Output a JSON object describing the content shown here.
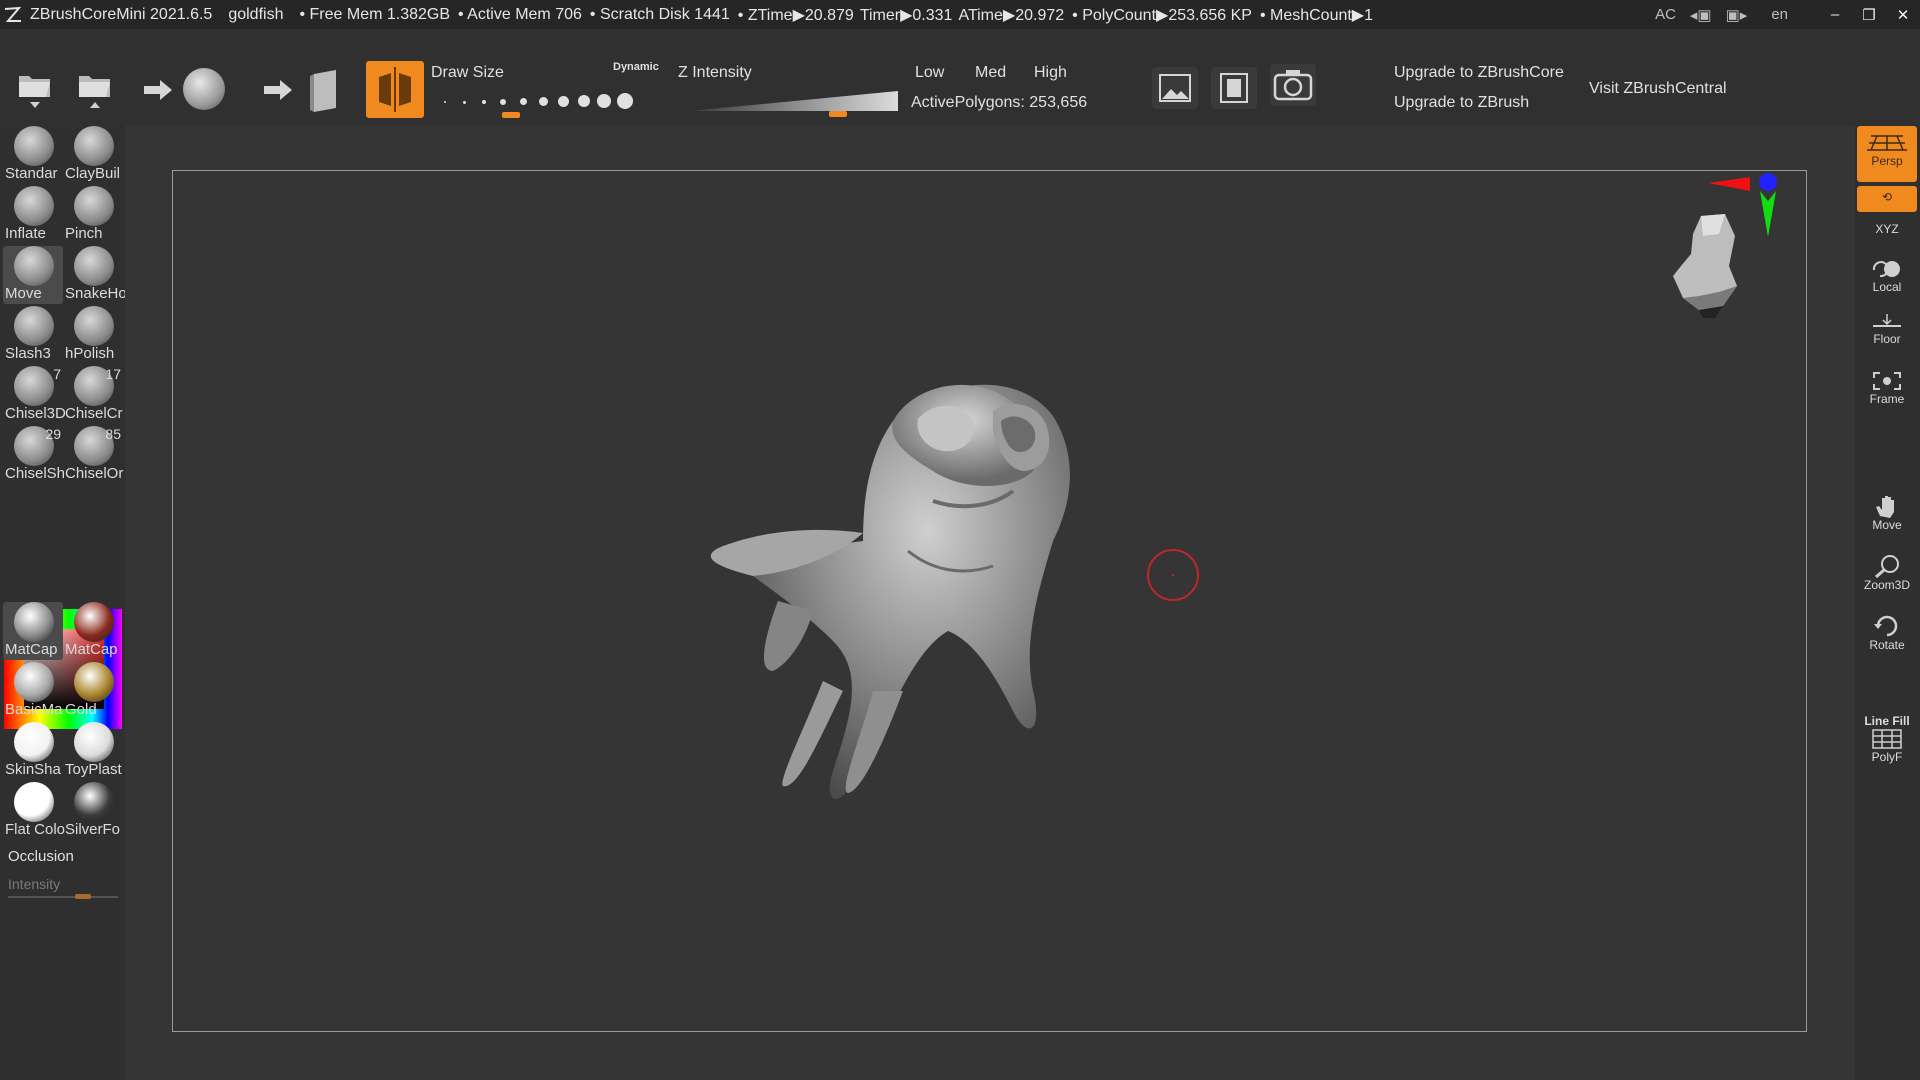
{
  "titlebar": {
    "app": "ZBrushCoreMini 2021.6.5",
    "document": "goldfish",
    "free_mem": "• Free Mem 1.382GB",
    "active_mem": "• Active Mem 706",
    "scratch": "• Scratch Disk 1441",
    "ztime": "• ZTime▶20.879",
    "timer": "Timer▶0.331",
    "atime": "ATime▶20.972",
    "polycount": "• PolyCount▶253.656 KP",
    "meshcount": "• MeshCount▶1",
    "ac": "AC",
    "lang": "en",
    "minimize": "–",
    "restore": "❐",
    "close": "✕"
  },
  "toolbar": {
    "draw_size_label": "Draw Size",
    "dynamic_label": "Dynamic",
    "z_intensity_label": "Z Intensity",
    "low": "Low",
    "med": "Med",
    "high": "High",
    "active_polygons": "ActivePolygons: 253,656",
    "upgrade_core": "Upgrade to ZBrushCore",
    "upgrade_zbrush": "Upgrade to ZBrush",
    "visit_central": "Visit ZBrushCentral"
  },
  "brushes": [
    {
      "name": "Standar",
      "badge": ""
    },
    {
      "name": "ClayBuil",
      "badge": ""
    },
    {
      "name": "Inflate",
      "badge": ""
    },
    {
      "name": "Pinch",
      "badge": ""
    },
    {
      "name": "Move",
      "badge": ""
    },
    {
      "name": "SnakeHo",
      "badge": ""
    },
    {
      "name": "Slash3",
      "badge": ""
    },
    {
      "name": "hPolish",
      "badge": ""
    },
    {
      "name": "Chisel3D",
      "badge": "7"
    },
    {
      "name": "ChiselCr",
      "badge": "17"
    },
    {
      "name": "ChiselSh",
      "badge": "29"
    },
    {
      "name": "ChiselOr",
      "badge": "85"
    }
  ],
  "materials": [
    {
      "name": "MatCap",
      "color": "#8d8d8d"
    },
    {
      "name": "MatCap",
      "color": "#8a2a1d"
    },
    {
      "name": "BasicMa",
      "color": "#a8a8a8"
    },
    {
      "name": "Gold",
      "color": "#a8842a"
    },
    {
      "name": "SkinSha",
      "color": "#f2f2f2"
    },
    {
      "name": "ToyPlast",
      "color": "#dcdcdc"
    },
    {
      "name": "Flat Colo",
      "color": "#ffffff"
    },
    {
      "name": "SilverFo",
      "color": "#3a3a3a"
    }
  ],
  "left": {
    "occlusion": "Occlusion",
    "intensity": "Intensity"
  },
  "right": {
    "persp": "Persp",
    "xyz": "XYZ",
    "local": "Local",
    "floor": "Floor",
    "frame": "Frame",
    "move": "Move",
    "zoom3d": "Zoom3D",
    "rotate": "Rotate",
    "line_fill": "Line Fill",
    "polyf": "PolyF"
  },
  "colors": {
    "accent": "#f08a1f",
    "cursor": "#c0262b"
  }
}
